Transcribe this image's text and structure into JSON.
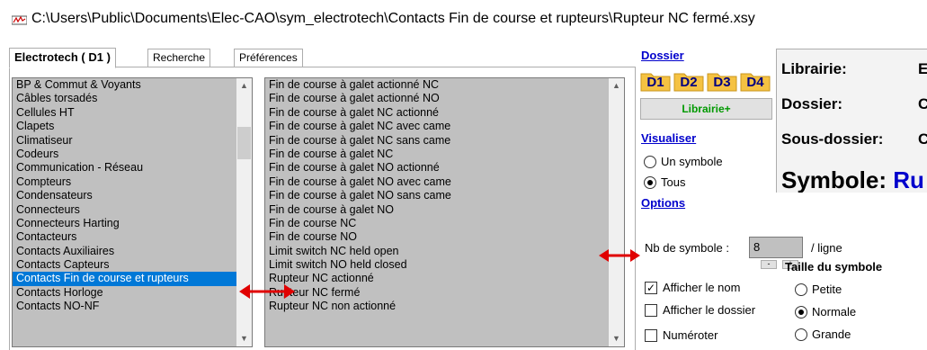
{
  "window": {
    "title": "C:\\Users\\Public\\Documents\\Elec-CAO\\sym_electrotech\\Contacts Fin de course et rupteurs\\Rupteur NC fermé.xsy"
  },
  "tabs": [
    {
      "label": "Electrotech ( D1 )",
      "active": true
    },
    {
      "label": "Recherche",
      "active": false
    },
    {
      "label": "Préférences",
      "active": false
    }
  ],
  "categories": {
    "items": [
      "BP & Commut & Voyants",
      "Câbles torsadés",
      "Cellules HT",
      "Clapets",
      "Climatiseur",
      "Codeurs",
      "Communication - Réseau",
      "Compteurs",
      "Condensateurs",
      "Connecteurs",
      "Connecteurs Harting",
      "Contacteurs",
      "Contacts Auxiliaires",
      "Contacts Capteurs",
      "Contacts Fin de course et rupteurs",
      "Contacts Horloge",
      "Contacts NO-NF"
    ],
    "selected_index": 14
  },
  "symbols": {
    "items": [
      "Fin de course à galet actionné NC",
      "Fin de course à galet actionné NO",
      "Fin de course à galet NC actionné",
      "Fin de course à galet NC avec came",
      "Fin de course à galet NC sans came",
      "Fin de course à galet NC",
      "Fin de course à galet NO actionné",
      "Fin de course à galet NO avec came",
      "Fin de course à galet NO sans came",
      "Fin de course à galet NO",
      "Fin de course NC",
      "Fin de course NO",
      "Limit switch NC held open",
      "Limit switch NO held closed",
      "Rupteur NC actionné",
      "Rupteur NC fermé",
      "Rupteur NC non actionné"
    ]
  },
  "dossier": {
    "label": "Dossier",
    "buttons": [
      "D1",
      "D2",
      "D3",
      "D4"
    ],
    "librairie_button": "Librairie+"
  },
  "visualiser": {
    "label": "Visualiser",
    "options": [
      "Un symbole",
      "Tous"
    ],
    "selected": "Tous"
  },
  "options": {
    "label": "Options",
    "nb_symbole_label": "Nb de symbole :",
    "nb_symbole_value": "8",
    "ligne_label": "/ ligne",
    "minus": "-",
    "plus": "+",
    "checkboxes": [
      {
        "label": "Afficher le nom",
        "checked": true
      },
      {
        "label": "Afficher le dossier",
        "checked": false
      },
      {
        "label": "Numéroter",
        "checked": false
      }
    ]
  },
  "taille": {
    "label": "Taille du symbole",
    "options": [
      "Petite",
      "Normale",
      "Grande"
    ],
    "selected": "Normale"
  },
  "info": {
    "librairie_label": "Librairie:",
    "librairie_value": "E",
    "dossier_label": "Dossier:",
    "dossier_value": "C",
    "sous_dossier_label": "Sous-dossier:",
    "sous_dossier_value": "C",
    "symbole_label": "Symbole:",
    "symbole_value": "Ru"
  },
  "colors": {
    "accent": "#0078d7",
    "link": "#0000cc",
    "folder": "#f5c242",
    "resize_arrow": "#e00000"
  }
}
